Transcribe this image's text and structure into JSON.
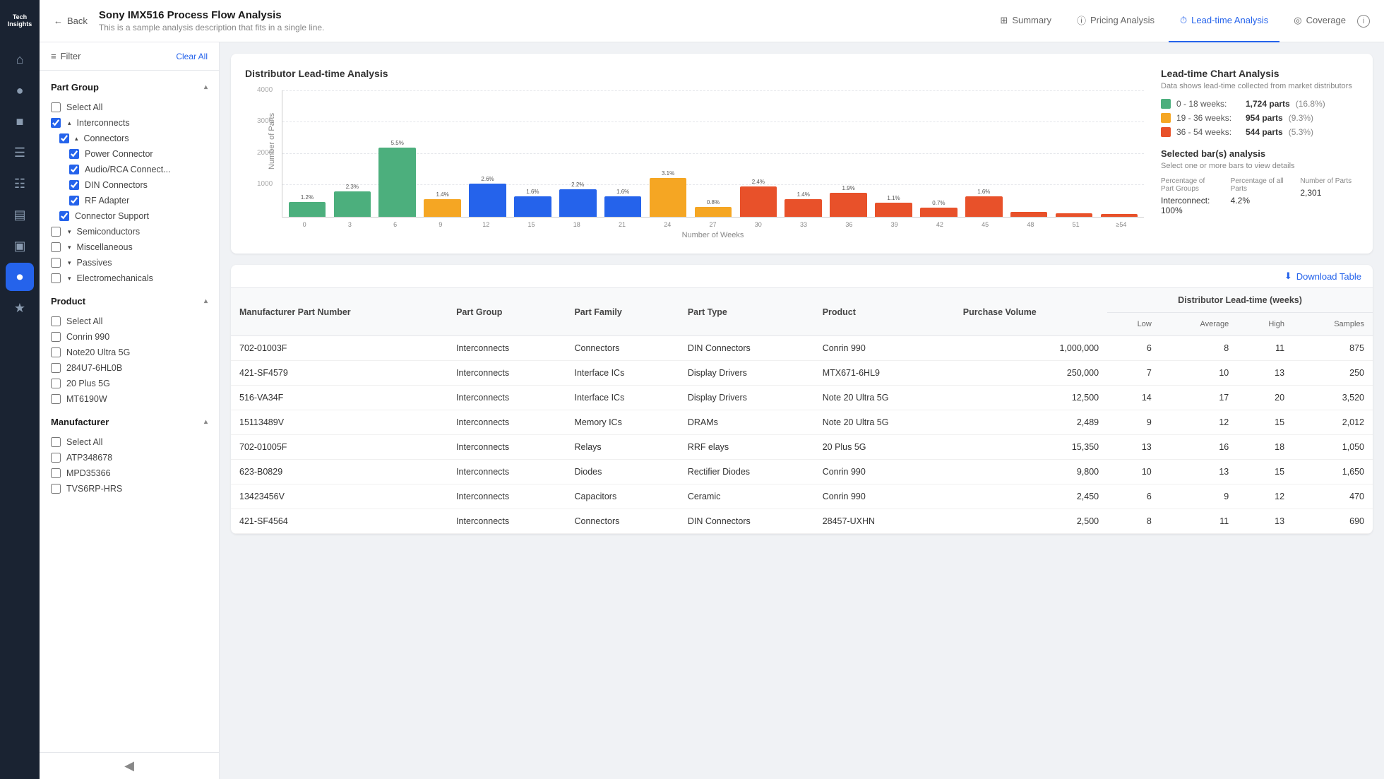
{
  "app": {
    "logo_line1": "Tech",
    "logo_line2": "Insights"
  },
  "header": {
    "back_label": "Back",
    "title": "Sony IMX516 Process Flow Analysis",
    "subtitle": "This is a sample analysis description that fits in a single line.",
    "nav_tabs": [
      {
        "id": "summary",
        "label": "Summary",
        "icon": "grid"
      },
      {
        "id": "pricing",
        "label": "Pricing Analysis",
        "icon": "info-circle"
      },
      {
        "id": "leadtime",
        "label": "Lead-time Analysis",
        "icon": "clock",
        "active": true
      },
      {
        "id": "coverage",
        "label": "Coverage",
        "icon": "globe"
      }
    ]
  },
  "filter": {
    "label": "Filter",
    "clear_label": "Clear All",
    "part_group_label": "Part Group",
    "select_all_label": "Select All",
    "groups": [
      {
        "id": "interconnects",
        "label": "Interconnects",
        "checked": true,
        "expanded": true,
        "children": [
          {
            "id": "connectors",
            "label": "Connectors",
            "checked": true,
            "expanded": true,
            "children": [
              {
                "id": "power_connector",
                "label": "Power Connector",
                "checked": true
              },
              {
                "id": "audio_rca",
                "label": "Audio/RCA Connect...",
                "checked": true
              },
              {
                "id": "din_connectors",
                "label": "DIN Connectors",
                "checked": true
              },
              {
                "id": "rf_adapter",
                "label": "RF Adapter",
                "checked": true
              }
            ]
          },
          {
            "id": "connector_support",
            "label": "Connector Support",
            "checked": true
          }
        ]
      },
      {
        "id": "semiconductors",
        "label": "Semiconductors",
        "checked": false,
        "expanded": false
      },
      {
        "id": "miscellaneous",
        "label": "Miscellaneous",
        "checked": false,
        "expanded": false
      },
      {
        "id": "passives",
        "label": "Passives",
        "checked": false,
        "expanded": false
      },
      {
        "id": "electromechanicals",
        "label": "Electromechanicals",
        "checked": false,
        "expanded": false
      }
    ],
    "product_section": {
      "label": "Product",
      "select_all_label": "Select All",
      "items": [
        {
          "id": "conrin990",
          "label": "Conrin 990",
          "checked": false
        },
        {
          "id": "note20ultra",
          "label": "Note20 Ultra 5G",
          "checked": false
        },
        {
          "id": "284u7_6hl0b",
          "label": "284U7-6HL0B",
          "checked": false
        },
        {
          "id": "20plus5g",
          "label": "20 Plus 5G",
          "checked": false
        },
        {
          "id": "mt6190w",
          "label": "MT6190W",
          "checked": false
        }
      ]
    },
    "manufacturer_section": {
      "label": "Manufacturer",
      "select_all_label": "Select All",
      "items": [
        {
          "id": "atp348678",
          "label": "ATP348678",
          "checked": false
        },
        {
          "id": "mpd35366",
          "label": "MPD35366",
          "checked": false
        },
        {
          "id": "tvs6rp_hrs",
          "label": "TVS6RP-HRS",
          "checked": false
        }
      ]
    }
  },
  "chart": {
    "title": "Distributor Lead-time Analysis",
    "y_axis_label": "Number of Parts",
    "x_axis_label": "Number of Weeks",
    "y_max": 4000,
    "y_ticks": [
      1000,
      2000,
      3000,
      4000
    ],
    "bars": [
      {
        "x": "0",
        "pct": "1.2%",
        "height_pct": 12,
        "color": "#4caf7d"
      },
      {
        "x": "3",
        "pct": "2.3%",
        "height_pct": 20,
        "color": "#4caf7d"
      },
      {
        "x": "6",
        "pct": "5.5%",
        "height_pct": 55,
        "color": "#4caf7d"
      },
      {
        "x": "9",
        "pct": "1.4%",
        "height_pct": 14,
        "color": "#f5a623"
      },
      {
        "x": "12",
        "pct": "2.6%",
        "height_pct": 26,
        "color": "#2563eb"
      },
      {
        "x": "15",
        "pct": "1.6%",
        "height_pct": 16,
        "color": "#2563eb"
      },
      {
        "x": "18",
        "pct": "2.2%",
        "height_pct": 22,
        "color": "#2563eb"
      },
      {
        "x": "21",
        "pct": "1.6%",
        "height_pct": 16,
        "color": "#2563eb"
      },
      {
        "x": "24",
        "pct": "3.1%",
        "height_pct": 31,
        "color": "#f5a623"
      },
      {
        "x": "27",
        "pct": "0.8%",
        "height_pct": 8,
        "color": "#f5a623"
      },
      {
        "x": "30",
        "pct": "2.4%",
        "height_pct": 24,
        "color": "#e8512a"
      },
      {
        "x": "33",
        "pct": "1.4%",
        "height_pct": 14,
        "color": "#e8512a"
      },
      {
        "x": "36",
        "pct": "1.9%",
        "height_pct": 19,
        "color": "#e8512a"
      },
      {
        "x": "39",
        "pct": "1.1%",
        "height_pct": 11,
        "color": "#e8512a"
      },
      {
        "x": "42",
        "pct": "0.7%",
        "height_pct": 7,
        "color": "#e8512a"
      },
      {
        "x": "45",
        "pct": "1.6%",
        "height_pct": 16,
        "color": "#e8512a"
      },
      {
        "x": "48",
        "pct": "",
        "height_pct": 4,
        "color": "#e8512a"
      },
      {
        "x": "51",
        "pct": "",
        "height_pct": 3,
        "color": "#e8512a"
      },
      {
        "x": "≥54",
        "pct": "",
        "height_pct": 2,
        "color": "#e8512a"
      }
    ]
  },
  "lead_time_analysis": {
    "title": "Lead-time Chart Analysis",
    "subtitle": "Data shows lead-time collected from market distributors",
    "ranges": [
      {
        "id": "range1",
        "color": "#4caf7d",
        "label": "0 - 18 weeks:",
        "parts": "1,724 parts",
        "pct": "(16.8%)"
      },
      {
        "id": "range2",
        "color": "#f5a623",
        "label": "19 - 36 weeks:",
        "parts": "954 parts",
        "pct": "(9.3%)"
      },
      {
        "id": "range3",
        "color": "#e8512a",
        "label": "36 - 54 weeks:",
        "parts": "544 parts",
        "pct": "(5.3%)"
      }
    ],
    "selected_title": "Selected bar(s) analysis",
    "selected_subtitle": "Select one or more bars to view details",
    "stats": [
      {
        "label": "Percentage of Part Groups",
        "value": "Interconnect: 100%"
      },
      {
        "label": "Percentage of all Parts",
        "value": "4.2%"
      },
      {
        "label": "Number of Parts",
        "value": "2,301"
      }
    ]
  },
  "table": {
    "download_label": "Download Table",
    "col_headers": [
      "Manufacturer Part Number",
      "Part Group",
      "Part Family",
      "Part Type",
      "Product",
      "Purchase Volume",
      "Distributor Lead-time (weeks)"
    ],
    "sub_headers": [
      "Low",
      "Average",
      "High",
      "Samples"
    ],
    "rows": [
      {
        "mpn": "702-01003F",
        "part_group": "Interconnects",
        "part_family": "Connectors",
        "part_type": "DIN Connectors",
        "product": "Conrin 990",
        "purchase_volume": "1,000,000",
        "low": 6,
        "avg": 8,
        "high": 11,
        "samples": 875
      },
      {
        "mpn": "421-SF4579",
        "part_group": "Interconnects",
        "part_family": "Interface ICs",
        "part_type": "Display Drivers",
        "product": "MTX671-6HL9",
        "purchase_volume": "250,000",
        "low": 7,
        "avg": 10,
        "high": 13,
        "samples": 250
      },
      {
        "mpn": "516-VA34F",
        "part_group": "Interconnects",
        "part_family": "Interface ICs",
        "part_type": "Display Drivers",
        "product": "Note 20 Ultra 5G",
        "purchase_volume": "12,500",
        "low": 14,
        "avg": 17,
        "high": 20,
        "samples": 3520
      },
      {
        "mpn": "15113489V",
        "part_group": "Interconnects",
        "part_family": "Memory ICs",
        "part_type": "DRAMs",
        "product": "Note 20 Ultra 5G",
        "purchase_volume": "2,489",
        "low": 9,
        "avg": 12,
        "high": 15,
        "samples": 2012
      },
      {
        "mpn": "702-01005F",
        "part_group": "Interconnects",
        "part_family": "Relays",
        "part_type": "RRF elays",
        "product": "20 Plus 5G",
        "purchase_volume": "15,350",
        "low": 13,
        "avg": 16,
        "high": 18,
        "samples": 1050
      },
      {
        "mpn": "623-B0829",
        "part_group": "Interconnects",
        "part_family": "Diodes",
        "part_type": "Rectifier Diodes",
        "product": "Conrin 990",
        "purchase_volume": "9,800",
        "low": 10,
        "avg": 13,
        "high": 15,
        "samples": 1650
      },
      {
        "mpn": "13423456V",
        "part_group": "Interconnects",
        "part_family": "Capacitors",
        "part_type": "Ceramic",
        "product": "Conrin 990",
        "purchase_volume": "2,450",
        "low": 6,
        "avg": 9,
        "high": 12,
        "samples": 470
      },
      {
        "mpn": "421-SF4564",
        "part_group": "Interconnects",
        "part_family": "Connectors",
        "part_type": "DIN Connectors",
        "product": "28457-UXHN",
        "purchase_volume": "2,500",
        "low": 8,
        "avg": 11,
        "high": 13,
        "samples": 690
      }
    ]
  },
  "icons": {
    "back_arrow": "←",
    "grid_icon": "⊞",
    "info_circle": "ⓘ",
    "clock_icon": "🕐",
    "globe_icon": "○",
    "filter_icon": "≡",
    "chevron_down": "▾",
    "chevron_up": "▴",
    "chevron_right": "▸",
    "download_icon": "⬇",
    "home_icon": "⌂",
    "search_icon": "🔍",
    "briefcase_icon": "📋",
    "chart_icon": "📊",
    "list_icon": "☰",
    "gear_icon": "⚙",
    "star_icon": "★",
    "settings_icon": "◈",
    "collapse_icon": "◀"
  }
}
